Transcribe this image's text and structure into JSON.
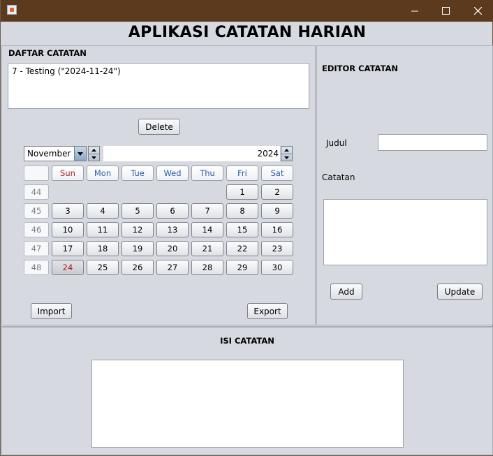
{
  "window": {
    "title": "APLIKASI CATATAN HARIAN",
    "titlebar_color": "#5c3a1e",
    "controls": [
      "minimize-icon",
      "maximize-icon",
      "close-icon"
    ]
  },
  "list_panel": {
    "title": "DAFTAR CATATAN",
    "items": [
      "7 - Testing (\"2024-11-24\")"
    ],
    "delete_label": "Delete",
    "import_label": "Import",
    "export_label": "Export"
  },
  "calendar": {
    "month": "November",
    "year": "2024",
    "day_headers": [
      "Sun",
      "Mon",
      "Tue",
      "Wed",
      "Thu",
      "Fri",
      "Sat"
    ],
    "weeks": [
      {
        "week": "44",
        "days": [
          "",
          "",
          "",
          "",
          "",
          "1",
          "2"
        ]
      },
      {
        "week": "45",
        "days": [
          "3",
          "4",
          "5",
          "6",
          "7",
          "8",
          "9"
        ]
      },
      {
        "week": "46",
        "days": [
          "10",
          "11",
          "12",
          "13",
          "14",
          "15",
          "16"
        ]
      },
      {
        "week": "47",
        "days": [
          "17",
          "18",
          "19",
          "20",
          "21",
          "22",
          "23"
        ]
      },
      {
        "week": "48",
        "days": [
          "24",
          "25",
          "26",
          "27",
          "28",
          "29",
          "30"
        ]
      }
    ],
    "selected_day": "24",
    "sunday_color": "#b01c1c",
    "weekday_color": "#2a5aa8"
  },
  "editor_panel": {
    "title": "EDITOR CATATAN",
    "judul_label": "Judul",
    "judul_value": "",
    "catatan_label": "Catatan",
    "catatan_value": "",
    "add_label": "Add",
    "update_label": "Update"
  },
  "content_panel": {
    "title": "ISI CATATAN",
    "content_value": ""
  }
}
